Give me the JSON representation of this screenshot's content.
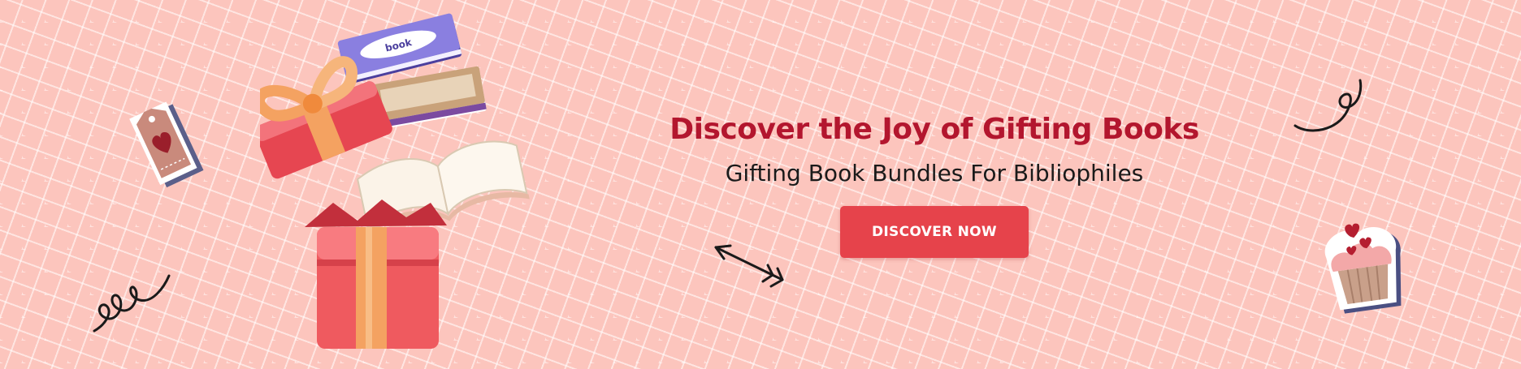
{
  "hero": {
    "headline": "Discover the Joy of Gifting Books",
    "subheadline": "Gifting Book Bundles For Bibliophiles",
    "cta_label": "DISCOVER NOW"
  },
  "theme": {
    "background": "#fcc5bd",
    "headline_color": "#b3162e",
    "cta_color": "#e6434b",
    "gift_box_color": "#ef5a5f",
    "ribbon_color": "#f4a261"
  },
  "decorations": [
    "gift-tag-sticker-icon",
    "squiggle-doodle-icon",
    "gift-box-with-books-illustration",
    "arrow-doodle-icon",
    "swirl-doodle-icon",
    "cupcake-sticker-icon"
  ]
}
